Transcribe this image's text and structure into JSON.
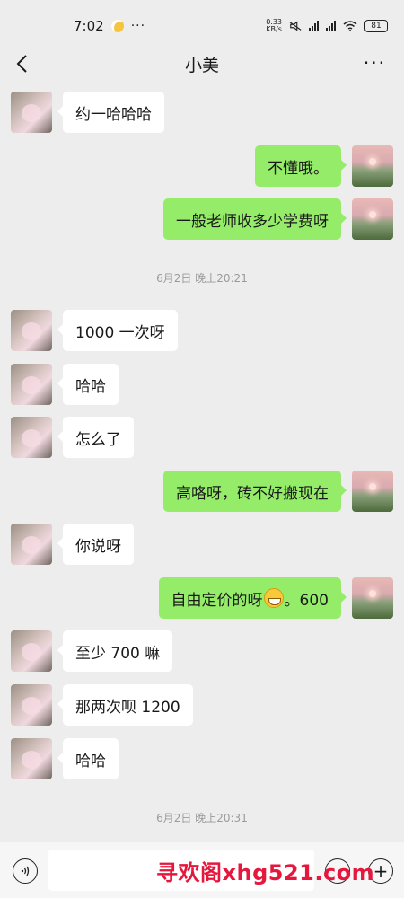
{
  "status_bar": {
    "time": "7:02",
    "dots": "···",
    "net_speed_value": "0.33",
    "net_speed_unit": "KB/s",
    "battery": "81"
  },
  "nav": {
    "title": "小美",
    "more": "···"
  },
  "messages": [
    {
      "side": "left",
      "text": "约一哈哈哈"
    },
    {
      "side": "right",
      "text": "不懂哦。"
    },
    {
      "side": "right",
      "text": "一般老师收多少学费呀"
    },
    {
      "side": "left",
      "text": "1000 一次呀"
    },
    {
      "side": "left",
      "text": "哈哈"
    },
    {
      "side": "left",
      "text": "怎么了"
    },
    {
      "side": "right",
      "text": "高咯呀，砖不好搬现在"
    },
    {
      "side": "left",
      "text": "你说呀"
    },
    {
      "side": "right",
      "text_before": "自由定价的呀",
      "emoji": "grinning-face",
      "text_after": "。600"
    },
    {
      "side": "left",
      "text": "至少 700 嘛"
    },
    {
      "side": "left",
      "text": "那两次呗 1200"
    },
    {
      "side": "left",
      "text": "哈哈"
    }
  ],
  "timestamps": [
    "6月2日 晚上20:21",
    "6月2日 晚上20:31"
  ],
  "watermark": "寻欢阁xhg521.com",
  "input_bar": {
    "placeholder": "",
    "plus": "+"
  }
}
